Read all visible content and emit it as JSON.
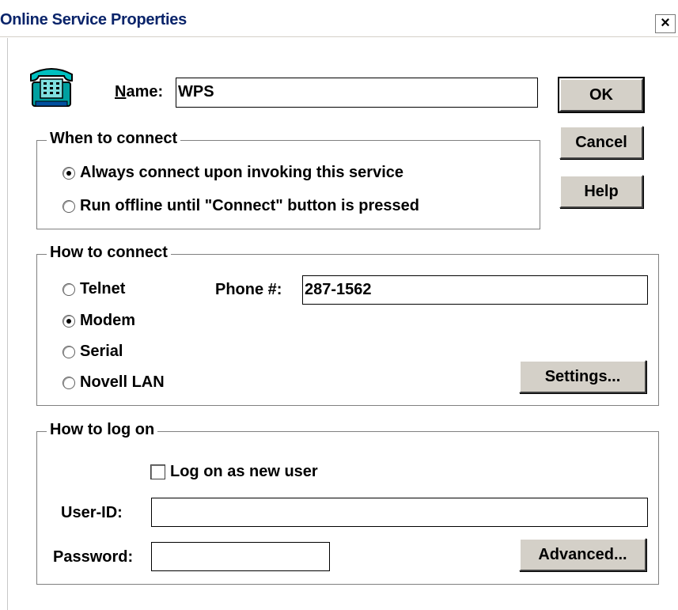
{
  "window": {
    "title": "Online Service Properties",
    "close_glyph": "×"
  },
  "name_field": {
    "label": "Name:",
    "value": "WPS"
  },
  "buttons": {
    "ok": "OK",
    "cancel": "Cancel",
    "help": "Help",
    "settings": "Settings...",
    "advanced": "Advanced..."
  },
  "when_group": {
    "title": "When to connect",
    "options": [
      {
        "label": "Always connect upon invoking this service",
        "selected": true
      },
      {
        "label": "Run offline until \"Connect\" button is pressed",
        "selected": false
      }
    ]
  },
  "how_group": {
    "title": "How to connect",
    "options": [
      {
        "label": "Telnet",
        "selected": false
      },
      {
        "label": "Modem",
        "selected": true
      },
      {
        "label": "Serial",
        "selected": false
      },
      {
        "label": "Novell LAN",
        "selected": false
      }
    ],
    "phone_label": "Phone #:",
    "phone_value": "287-1562"
  },
  "logon_group": {
    "title": "How to log on",
    "new_user_label": "Log on as new user",
    "new_user_checked": false,
    "userid_label": "User-ID:",
    "userid_value": "",
    "password_label": "Password:",
    "password_value": ""
  },
  "icons": {
    "app": "telephone-icon"
  },
  "colors": {
    "title_text": "#0a246a",
    "button_face": "#d4d0c8"
  }
}
